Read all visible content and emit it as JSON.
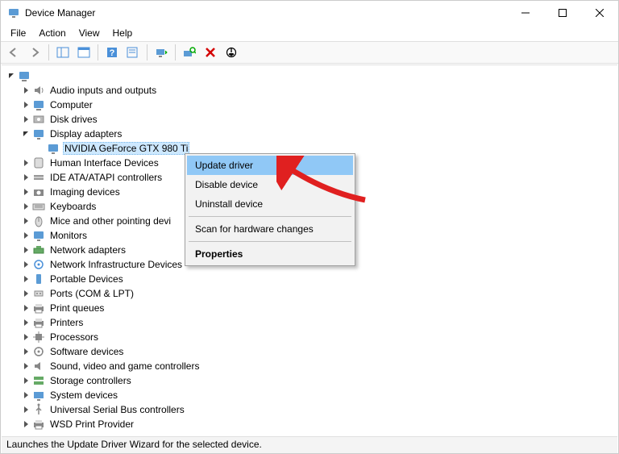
{
  "window": {
    "title": "Device Manager"
  },
  "menu": {
    "file": "File",
    "action": "Action",
    "view": "View",
    "help": "Help"
  },
  "tree": {
    "root": "",
    "items": [
      {
        "label": "Audio inputs and outputs",
        "icon": "speaker"
      },
      {
        "label": "Computer",
        "icon": "computer"
      },
      {
        "label": "Disk drives",
        "icon": "disk"
      },
      {
        "label": "Display adapters",
        "icon": "monitor",
        "expanded": true,
        "children": [
          {
            "label": "NVIDIA GeForce GTX 980 Ti",
            "icon": "monitor",
            "selected": true
          }
        ]
      },
      {
        "label": "Human Interface Devices",
        "icon": "hid"
      },
      {
        "label": "IDE ATA/ATAPI controllers",
        "icon": "ide"
      },
      {
        "label": "Imaging devices",
        "icon": "camera"
      },
      {
        "label": "Keyboards",
        "icon": "keyboard"
      },
      {
        "label": "Mice and other pointing devi",
        "icon": "mouse"
      },
      {
        "label": "Monitors",
        "icon": "monitor"
      },
      {
        "label": "Network adapters",
        "icon": "network"
      },
      {
        "label": "Network Infrastructure Devices",
        "icon": "netinfra"
      },
      {
        "label": "Portable Devices",
        "icon": "portable"
      },
      {
        "label": "Ports (COM & LPT)",
        "icon": "port"
      },
      {
        "label": "Print queues",
        "icon": "printer"
      },
      {
        "label": "Printers",
        "icon": "printer"
      },
      {
        "label": "Processors",
        "icon": "cpu"
      },
      {
        "label": "Software devices",
        "icon": "software"
      },
      {
        "label": "Sound, video and game controllers",
        "icon": "sound"
      },
      {
        "label": "Storage controllers",
        "icon": "storage"
      },
      {
        "label": "System devices",
        "icon": "system"
      },
      {
        "label": "Universal Serial Bus controllers",
        "icon": "usb"
      },
      {
        "label": "WSD Print Provider",
        "icon": "printer"
      }
    ]
  },
  "context_menu": {
    "update": "Update driver",
    "disable": "Disable device",
    "uninstall": "Uninstall device",
    "scan": "Scan for hardware changes",
    "properties": "Properties"
  },
  "status_bar": {
    "text": "Launches the Update Driver Wizard for the selected device."
  }
}
